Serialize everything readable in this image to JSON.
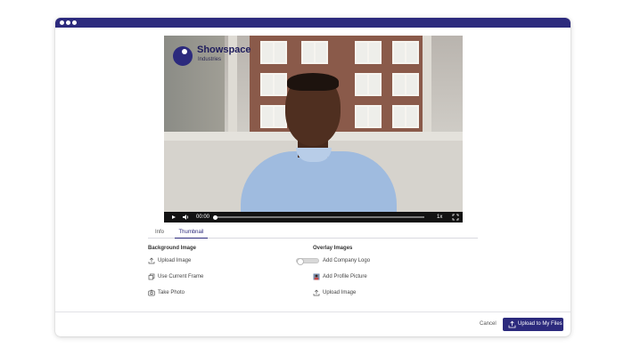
{
  "brand": {
    "name": "Showspace",
    "subtitle": "Industries"
  },
  "player": {
    "time": "00:00",
    "speed": "1x",
    "progress": 0.0
  },
  "tabs": [
    {
      "label": "Info",
      "active": false
    },
    {
      "label": "Thumbnail",
      "active": true
    }
  ],
  "background_image": {
    "title": "Background Image",
    "options": [
      {
        "label": "Upload Image",
        "icon": "upload-icon"
      },
      {
        "label": "Use Current Frame",
        "icon": "frames-icon"
      },
      {
        "label": "Take Photo",
        "icon": "camera-icon"
      }
    ]
  },
  "overlay_images": {
    "title": "Overlay Images",
    "options": [
      {
        "label": "Add Company Logo",
        "icon": "toggle-switch",
        "enabled": false
      },
      {
        "label": "Add Profile Picture",
        "icon": "profile-picture-icon"
      },
      {
        "label": "Upload Image",
        "icon": "upload-icon"
      }
    ]
  },
  "footer": {
    "cancel_label": "Cancel",
    "primary_label": "Upload to My Files"
  },
  "colors": {
    "accent": "#2c2a7d",
    "titlebar": "#2c2a7d"
  }
}
